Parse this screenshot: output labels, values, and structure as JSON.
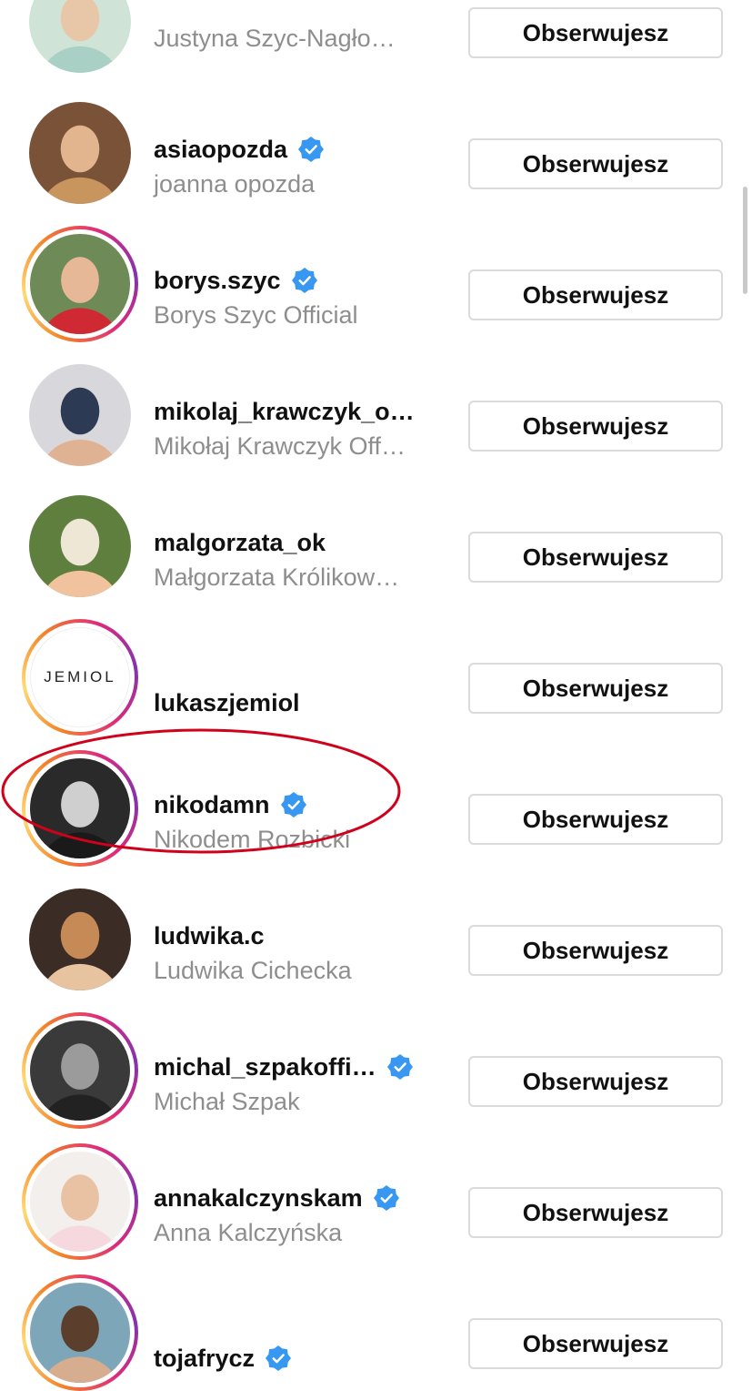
{
  "accounts": [
    {
      "username": "",
      "fullname": "Justyna Szyc-Nagło…",
      "verified": false,
      "ring": false,
      "button": "Obserwujesz",
      "avatar": "photo-avatar"
    },
    {
      "username": "asiaopozda",
      "fullname": "joanna opozda",
      "verified": true,
      "ring": false,
      "button": "Obserwujesz",
      "avatar": "photo-avatar"
    },
    {
      "username": "borys.szyc",
      "fullname": "Borys Szyc Official",
      "verified": true,
      "ring": true,
      "button": "Obserwujesz",
      "avatar": "photo-avatar"
    },
    {
      "username": "mikolaj_krawczyk_o…",
      "fullname": "Mikołaj Krawczyk Off…",
      "verified": false,
      "ring": false,
      "button": "Obserwujesz",
      "avatar": "photo-avatar"
    },
    {
      "username": "malgorzata_ok",
      "fullname": "Małgorzata Królikow…",
      "verified": false,
      "ring": false,
      "button": "Obserwujesz",
      "avatar": "photo-avatar"
    },
    {
      "username": "lukaszjemiol",
      "fullname": "",
      "verified": false,
      "ring": true,
      "button": "Obserwujesz",
      "avatar": "logo-avatar",
      "logo_text": "JEMIOL"
    },
    {
      "username": "nikodamn",
      "fullname": "Nikodem Rozbicki",
      "verified": true,
      "ring": true,
      "button": "Obserwujesz",
      "avatar": "photo-avatar"
    },
    {
      "username": "ludwika.c",
      "fullname": "Ludwika Cichecka",
      "verified": false,
      "ring": false,
      "button": "Obserwujesz",
      "avatar": "photo-avatar"
    },
    {
      "username": "michal_szpakoffi…",
      "fullname": "Michał Szpak",
      "verified": true,
      "ring": true,
      "button": "Obserwujesz",
      "avatar": "photo-avatar"
    },
    {
      "username": "annakalczynskam",
      "fullname": "Anna Kalczyńska",
      "verified": true,
      "ring": true,
      "button": "Obserwujesz",
      "avatar": "photo-avatar"
    },
    {
      "username": "tojafrycz",
      "fullname": "",
      "verified": true,
      "ring": true,
      "button": "Obserwujesz",
      "avatar": "photo-avatar"
    }
  ],
  "colors": {
    "verified_badge": "#3897f0",
    "highlight_ellipse": "#d0021b",
    "secondary_text": "#8e8e8e",
    "button_border": "#dbdbdb"
  },
  "icons": {
    "verified": "verified-badge-icon"
  }
}
